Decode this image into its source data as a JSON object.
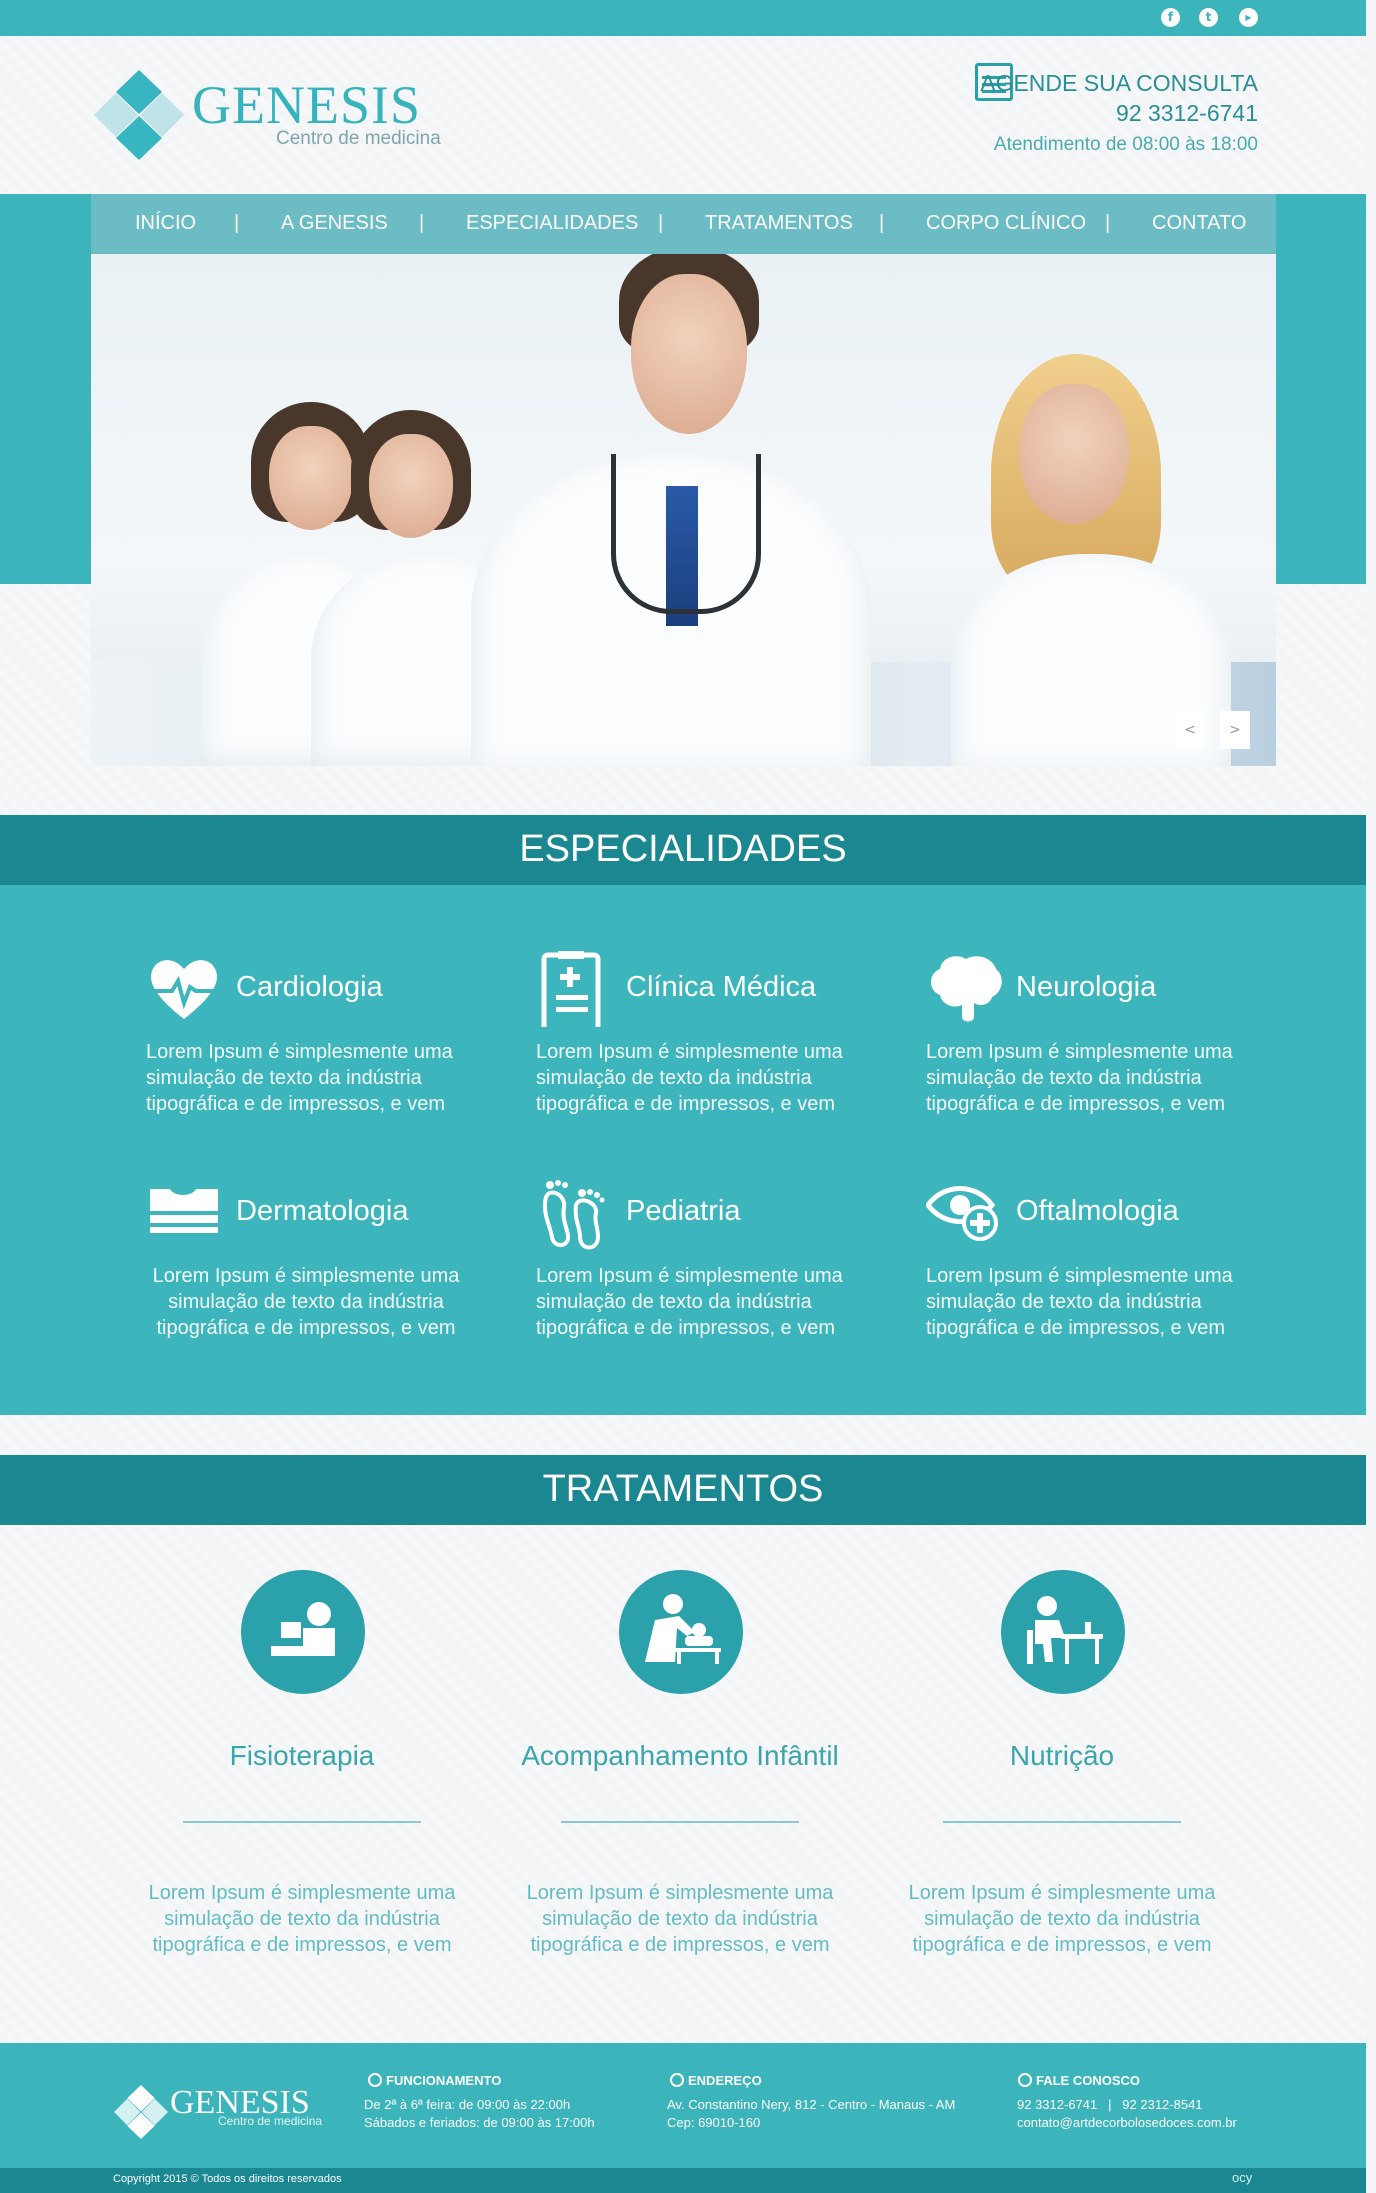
{
  "social": {
    "icons": [
      {
        "name": "facebook-icon",
        "glyph": "f"
      },
      {
        "name": "twitter-icon",
        "glyph": "t"
      },
      {
        "name": "youtube-icon",
        "glyph": "▶"
      }
    ]
  },
  "header": {
    "brand": "GENESIS",
    "tagline": "Centro de medicina",
    "cta_title": "AGENDE SUA CONSULTA",
    "cta_phone": "92 3312-6741",
    "cta_hours": "Atendimento de 08:00 às 18:00"
  },
  "nav": {
    "items": [
      "INÍCIO",
      "A GENESIS",
      "ESPECIALIDADES",
      "TRATAMENTOS",
      "CORPO CLÍNICO",
      "CONTATO"
    ],
    "separator": "|"
  },
  "slider": {
    "prev": "<",
    "next": ">"
  },
  "especialidades": {
    "title": "ESPECIALIDADES",
    "items": [
      {
        "name": "Cardiologia",
        "icon": "heart-icon",
        "text": "Lorem Ipsum é simplesmente uma simulação de texto da indústria tipográfica e de impressos, e vem"
      },
      {
        "name": "Clínica Médica",
        "icon": "clipboard-icon",
        "text": "Lorem Ipsum é simplesmente uma simulação de texto da indústria tipográfica e de impressos, e vem"
      },
      {
        "name": "Neurologia",
        "icon": "brain-icon",
        "text": "Lorem Ipsum é simplesmente uma simulação de texto da indústria tipográfica e de impressos, e vem"
      },
      {
        "name": "Dermatologia",
        "icon": "skin-layers-icon",
        "text": "Lorem Ipsum é simplesmente uma simulação de texto da indústria tipográfica e de impressos, e vem"
      },
      {
        "name": "Pediatria",
        "icon": "footprints-icon",
        "text": "Lorem Ipsum é simplesmente uma simulação de texto da indústria tipográfica e de impressos, e vem"
      },
      {
        "name": "Oftalmologia",
        "icon": "eye-plus-icon",
        "text": "Lorem Ipsum é simplesmente uma simulação de texto da indústria tipográfica e de impressos, e vem"
      }
    ]
  },
  "tratamentos": {
    "title": "TRATAMENTOS",
    "items": [
      {
        "name": "Fisioterapia",
        "icon": "physio-icon",
        "text": "Lorem Ipsum é simplesmente uma simulação de texto da indústria tipográfica e de impressos, e vem"
      },
      {
        "name": "Acompanhamento Infântil",
        "icon": "baby-care-icon",
        "text": "Lorem Ipsum é simplesmente uma simulação de texto da indústria tipográfica e de impressos, e vem"
      },
      {
        "name": "Nutrição",
        "icon": "dining-icon",
        "text": "Lorem Ipsum é simplesmente uma simulação de texto da indústria tipográfica e de impressos, e vem"
      }
    ]
  },
  "footer": {
    "brand": "GENESIS",
    "tagline": "Centro de medicina",
    "funcionamento": {
      "title": "FUNCIONAMENTO",
      "line1": "De 2ª à 6ª feira: de 09:00 às 22:00h",
      "line2": "Sábados e feriados: de 09:00 às 17:00h"
    },
    "endereco": {
      "title": "ENDEREÇO",
      "line1": "Av. Constantino Nery, 812 - Centro - Manaus - AM",
      "line2": "Cep: 69010-160"
    },
    "contato": {
      "title": "FALE CONOSCO",
      "line1": "92 3312-6741   |   92 2312-8541",
      "line2": "contato@artdecorbolosedoces.com.br"
    },
    "copyright": "Copyright 2015 © Todos os direitos reservados",
    "credit": "ocy"
  },
  "colors": {
    "teal": "#3bb4bb",
    "teal_dark": "#1b8790",
    "text_teal": "#3ba5ad"
  }
}
